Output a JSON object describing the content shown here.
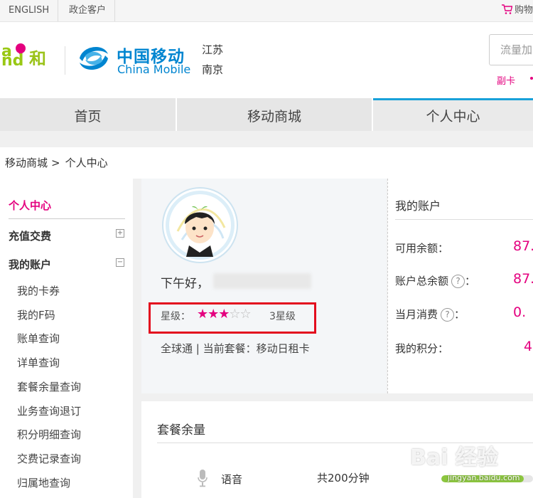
{
  "topbar": {
    "english": "ENGLISH",
    "gov": "政企客户",
    "cart": "购物"
  },
  "header": {
    "logo_he_latin": "a nd",
    "logo_he_cn": "和",
    "logo_cm_cn": "中国移动",
    "logo_cm_en": "China Mobile",
    "province": "江苏",
    "city": "南京",
    "search_placeholder": "流量加",
    "fuka": "副卡"
  },
  "nav": {
    "tabs": [
      {
        "label": "首页"
      },
      {
        "label": "移动商城"
      },
      {
        "label": "个人中心"
      }
    ]
  },
  "breadcrumb": {
    "mall": "移动商城",
    "sep": ">",
    "current": "个人中心"
  },
  "sidebar": {
    "center": "个人中心",
    "recharge": "充值交费",
    "recharge_toggle": "+",
    "account": "我的账户",
    "account_toggle": "−",
    "items": [
      {
        "label": "我的卡券"
      },
      {
        "label": "我的F码"
      },
      {
        "label": "账单查询"
      },
      {
        "label": "详单查询"
      },
      {
        "label": "套餐余量查询"
      },
      {
        "label": "业务查询退订"
      },
      {
        "label": "积分明细查询"
      },
      {
        "label": "交费记录查询"
      },
      {
        "label": "归属地查询"
      }
    ]
  },
  "profile": {
    "greeting": "下午好，",
    "level_label": "星级：",
    "stars_on": "★★★",
    "stars_off": "☆☆",
    "level_text": "3星级",
    "package_line": "全球通 | 当前套餐：移动日租卡",
    "star_rating": 3,
    "star_max": 5
  },
  "account": {
    "title": "我的账户",
    "rows": [
      {
        "label": "可用余额：",
        "value": "87.",
        "help": ""
      },
      {
        "label": "账户总余额",
        "value": "87.",
        "help": "?"
      },
      {
        "label": "当月消费",
        "value": "0.",
        "help": "?"
      },
      {
        "label": "我的积分：",
        "value": "4",
        "help": ""
      }
    ],
    "colon": "："
  },
  "package": {
    "title": "套餐余量",
    "voice_label": "语音",
    "voice_total": "共200分钟",
    "voice_fill": 0.9
  },
  "watermark": {
    "main": "Bai 经验",
    "url": "jingyan.baidu.com"
  },
  "colors": {
    "brand_pink": "#e4007f",
    "brand_blue": "#0085d0",
    "highlight_red": "#e30c1e",
    "bar_green": "#8cc63f"
  }
}
